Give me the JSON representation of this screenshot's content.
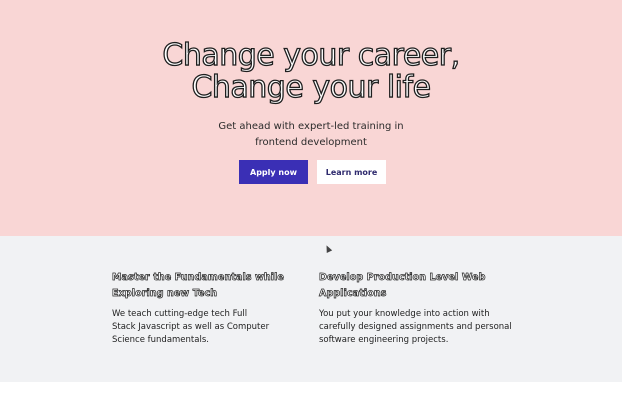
{
  "hero": {
    "title_line1": "Change your career,",
    "title_line2": "Change your life",
    "subtitle_line1": "Get ahead with expert-led training in",
    "subtitle_line2": "frontend development",
    "apply_label": "Apply now",
    "learn_label": "Learn more"
  },
  "features": [
    {
      "title_line1": "Master the Fundamentals while",
      "title_line2": "Exploring new Tech",
      "text_line1": "We teach cutting-edge tech Full",
      "text_line2": "Stack Javascript as well as Computer",
      "text_line3": "Science fundamentals."
    },
    {
      "title_line1": "Develop Production Level Web",
      "title_line2": "Applications",
      "text_line1": "You put your knowledge into action with",
      "text_line2": "carefully designed assignments and personal",
      "text_line3": "software engineering projects."
    }
  ],
  "colors": {
    "hero_bg": "#f9d6d5",
    "apply_bg": "#3a2fb5",
    "features_bg": "#f1f2f4"
  }
}
